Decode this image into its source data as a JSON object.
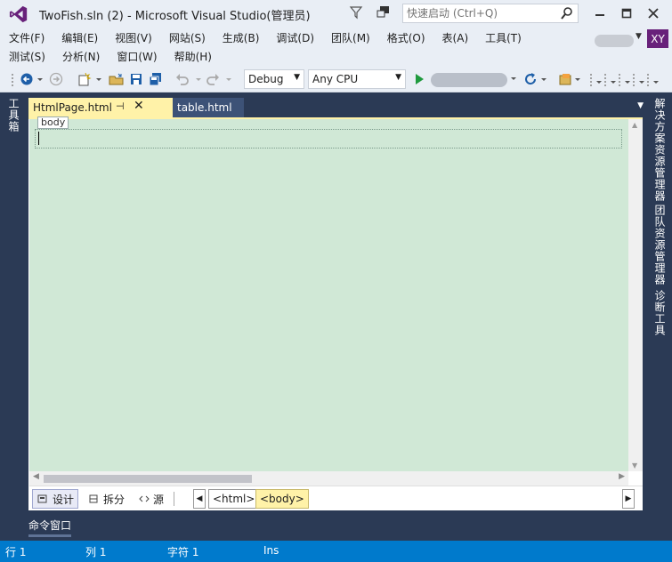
{
  "window": {
    "title": "TwoFish.sln (2) - Microsoft Visual Studio(管理员)",
    "quick_launch_placeholder": "快速启动 (Ctrl+Q)",
    "account_initials": "XY"
  },
  "menu": {
    "row1": [
      "文件(F)",
      "编辑(E)",
      "视图(V)",
      "网站(S)",
      "生成(B)",
      "调试(D)",
      "团队(M)",
      "格式(O)",
      "表(A)",
      "工具(T)"
    ],
    "row2": [
      "测试(S)",
      "分析(N)",
      "窗口(W)",
      "帮助(H)"
    ]
  },
  "toolbar": {
    "configuration": "Debug",
    "platform": "Any CPU"
  },
  "left_panel": {
    "toolbox_label": "工具箱"
  },
  "right_panel": {
    "labels": [
      "解决方案资源管理器",
      "团队资源管理器",
      "诊断工具"
    ]
  },
  "tabs": [
    {
      "label": "HtmlPage.html",
      "active": true
    },
    {
      "label": "table.html",
      "active": false
    }
  ],
  "editor": {
    "body_tag_label": "body"
  },
  "view_bar": {
    "design": "设计",
    "split": "拆分",
    "source": "源",
    "breadcrumbs": [
      "<html>",
      "<body>"
    ]
  },
  "command_window": {
    "label": "命令窗口"
  },
  "status": {
    "line": "行 1",
    "col": "列 1",
    "char": "字符 1",
    "mode": "Ins"
  },
  "colors": {
    "accent": "#007acc",
    "chrome": "#e9eef5",
    "frame": "#2b3a55",
    "active_tab": "#fff2a8",
    "design_surface": "#d0e8d6",
    "vs_purple": "#68217a"
  }
}
